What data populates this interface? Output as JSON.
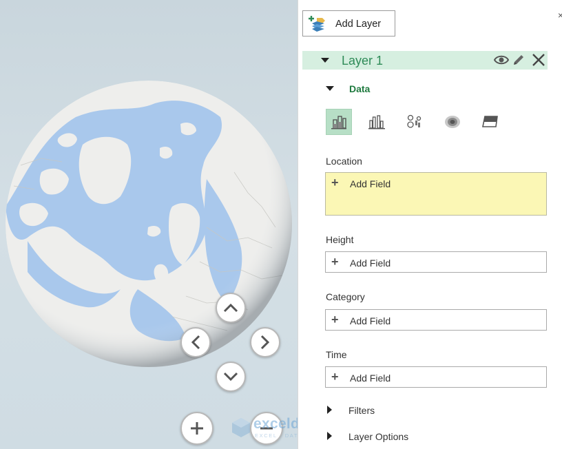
{
  "pane": {
    "add_layer_label": "Add Layer",
    "close_glyph": "×",
    "layer": {
      "title": "Layer 1"
    },
    "data_section": {
      "title": "Data",
      "viz_types": [
        {
          "icon": "stacked-column-icon",
          "selected": true
        },
        {
          "icon": "clustered-column-icon",
          "selected": false
        },
        {
          "icon": "bubble-icon",
          "selected": false
        },
        {
          "icon": "heat-map-icon",
          "selected": false
        },
        {
          "icon": "region-icon",
          "selected": false
        }
      ],
      "fields": [
        {
          "label": "Location",
          "placeholder": "Add Field"
        },
        {
          "label": "Height",
          "placeholder": "Add Field"
        },
        {
          "label": "Category",
          "placeholder": "Add Field"
        },
        {
          "label": "Time",
          "placeholder": "Add Field"
        }
      ]
    },
    "collapsed_sections": [
      "Filters",
      "Layer Options"
    ]
  },
  "watermark": {
    "name": "exceldemy",
    "sub": "EXCEL · DATA · BI"
  },
  "colors": {
    "accent_green": "#2e8b57",
    "layer_header_bg": "#d6efe0",
    "location_box_bg": "#fbf7b5",
    "ocean": "#a9c8ec",
    "land": "#ececea"
  }
}
